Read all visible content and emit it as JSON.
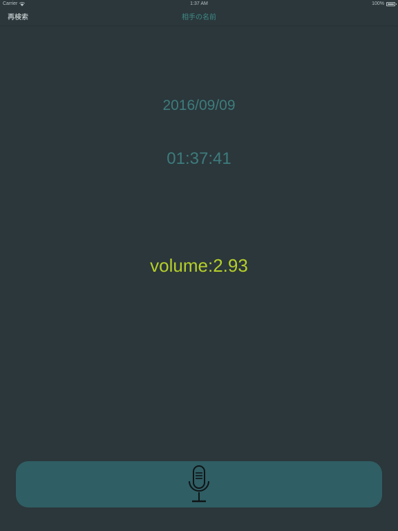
{
  "status_bar": {
    "carrier": "Carrier",
    "time": "1:37 AM",
    "battery": "100%"
  },
  "nav": {
    "back_label": "再検索",
    "title": "相手の名前"
  },
  "main": {
    "date": "2016/09/09",
    "time": "01:37:41",
    "volume": "volume:2.93"
  },
  "record_button": {
    "icon": "microphone-icon"
  },
  "colors": {
    "background": "#2b373b",
    "date_time_text": "#3e7c7d",
    "volume_text": "#b6cf2a",
    "button_fill": "#2f5e64",
    "nav_title": "#3f8a86"
  }
}
